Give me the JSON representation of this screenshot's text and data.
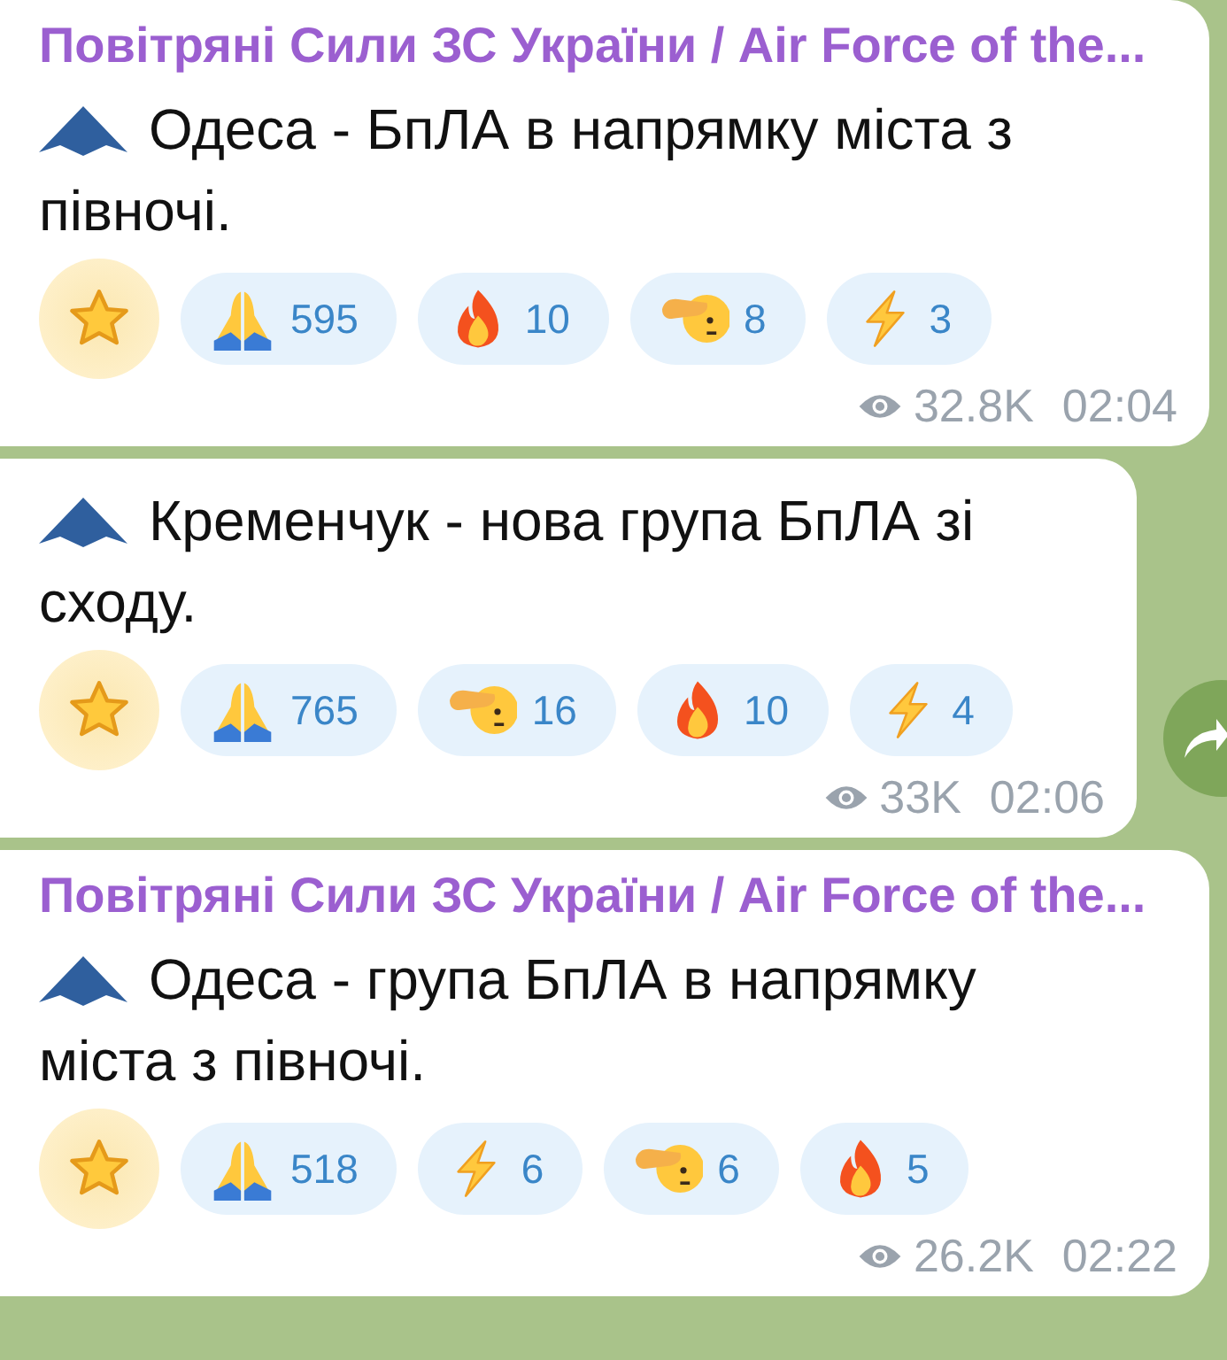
{
  "messages": [
    {
      "sender": "Повітряні Сили ЗС України / Air Force of the...",
      "text": "Одеса - БпЛА в напрямку міста з півночі.",
      "reactions": [
        {
          "kind": "star"
        },
        {
          "kind": "pray",
          "count": "595"
        },
        {
          "kind": "fire",
          "count": "10"
        },
        {
          "kind": "salute",
          "count": "8"
        },
        {
          "kind": "bolt",
          "count": "3"
        }
      ],
      "views": "32.8K",
      "time": "02:04"
    },
    {
      "text": "Кременчук - нова група БпЛА зі сходу.",
      "reactions": [
        {
          "kind": "star"
        },
        {
          "kind": "pray",
          "count": "765"
        },
        {
          "kind": "salute",
          "count": "16"
        },
        {
          "kind": "fire",
          "count": "10"
        },
        {
          "kind": "bolt",
          "count": "4"
        }
      ],
      "views": "33K",
      "time": "02:06",
      "share_button": true
    },
    {
      "sender": "Повітряні Сили ЗС України / Air Force of the...",
      "text": "Одеса - група БпЛА в напрямку міста з півночі.",
      "reactions": [
        {
          "kind": "star"
        },
        {
          "kind": "pray",
          "count": "518"
        },
        {
          "kind": "bolt",
          "count": "6"
        },
        {
          "kind": "salute",
          "count": "6"
        },
        {
          "kind": "fire",
          "count": "5"
        }
      ],
      "views": "26.2K",
      "time": "02:22"
    }
  ]
}
